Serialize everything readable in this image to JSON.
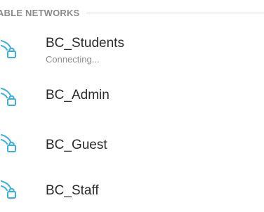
{
  "section": {
    "title": "ABLE NETWORKS"
  },
  "colors": {
    "accent": "#3bb0dd",
    "header_text": "#8a8a8a",
    "divider": "#d9d9d9",
    "primary_text": "#2b2b2b",
    "secondary_text": "#8d8d8d"
  },
  "networks": [
    {
      "name": "BC_Students",
      "status": "Connecting...",
      "icon": "wifi-locked-icon"
    },
    {
      "name": "BC_Admin",
      "status": "",
      "icon": "wifi-locked-icon"
    },
    {
      "name": "BC_Guest",
      "status": "",
      "icon": "wifi-locked-icon"
    },
    {
      "name": "BC_Staff",
      "status": "",
      "icon": "wifi-locked-icon"
    }
  ]
}
